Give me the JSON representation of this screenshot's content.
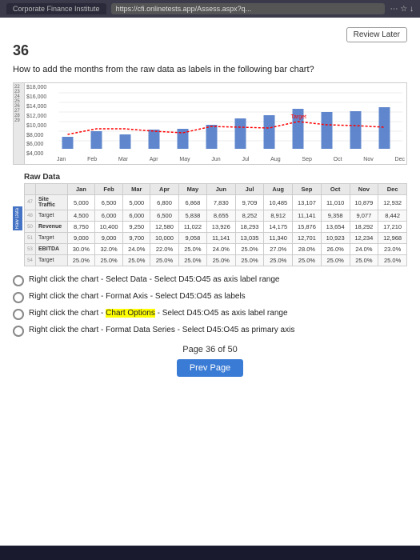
{
  "browser": {
    "tab_label": "Corporate Finance Institute",
    "url": "https://cfi.onlinetests.app/Assess.aspx?q...",
    "review_later": "Review Later"
  },
  "question": {
    "number": "36",
    "text": "How to add the months from the raw data as labels in the following bar chart?"
  },
  "chart": {
    "y_labels": [
      "$18,000",
      "$16,000",
      "$14,000",
      "$12,000",
      "$10,000",
      "$8,000",
      "$6,000",
      "$4,000"
    ],
    "x_labels": [
      "Jan",
      "Feb",
      "Mar",
      "Apr",
      "May",
      "Jun",
      "Jul",
      "Aug",
      "Sep",
      "Oct",
      "Nov",
      "Dec"
    ],
    "target_label": "Target"
  },
  "raw_data": {
    "title": "Raw Data",
    "columns": [
      "",
      "Jan",
      "Feb",
      "Mar",
      "Apr",
      "May",
      "Jun",
      "Jul",
      "Aug",
      "Sep",
      "Oct",
      "Nov",
      "Dec"
    ],
    "rows": [
      {
        "label": "Site Traffic",
        "row_num": "47",
        "values": [
          "5,000",
          "6,500",
          "5,000",
          "6,800",
          "6,868",
          "7,830",
          "9,709",
          "10,485",
          "13,107",
          "11,010",
          "10,879",
          "12,932"
        ]
      },
      {
        "label": "Target",
        "row_num": "48",
        "values": [
          "4,500",
          "6,000",
          "6,000",
          "6,500",
          "5,838",
          "8,655",
          "8,252",
          "8,912",
          "11,141",
          "9,358",
          "9,077",
          "8,442"
        ]
      },
      {
        "label": "Revenue",
        "row_num": "50",
        "values": [
          "8,750",
          "10,400",
          "9,250",
          "12,580",
          "11,022",
          "13,926",
          "18,293",
          "14,175",
          "15,876",
          "13,654",
          "18,292",
          "17,210"
        ]
      },
      {
        "label": "Target",
        "row_num": "51",
        "values": [
          "9,000",
          "9,000",
          "9,700",
          "10,000",
          "9,058",
          "11,141",
          "13,035",
          "11,340",
          "12,701",
          "10,923",
          "12,234",
          "12,968"
        ]
      },
      {
        "label": "EBITDA",
        "row_num": "53",
        "values": [
          "30.0%",
          "32.0%",
          "24.0%",
          "22.0%",
          "25.0%",
          "24.0%",
          "25.0%",
          "27.0%",
          "28.0%",
          "26.0%",
          "24.0%",
          "23.0%"
        ]
      },
      {
        "label": "Target",
        "row_num": "54",
        "values": [
          "25.0%",
          "25.0%",
          "25.0%",
          "25.0%",
          "25.0%",
          "25.0%",
          "25.0%",
          "25.0%",
          "25.0%",
          "25.0%",
          "25.0%",
          "25.0%"
        ]
      }
    ]
  },
  "options": [
    {
      "id": "opt1",
      "text": "Right click the chart - Select Data - Select D45:O45 as axis label range"
    },
    {
      "id": "opt2",
      "text": "Right click the chart - Format Axis - Select D45:O45 as labels"
    },
    {
      "id": "opt3",
      "text": "Right click the chart - Chart Options - Select D45:O45 as axis label range"
    },
    {
      "id": "opt4",
      "text": "Right click the chart - Format Data Series - Select D45:O45 as primary axis"
    }
  ],
  "pagination": {
    "current": "36",
    "total": "50",
    "page_label": "Page 36 of 50",
    "prev_label": "Prev Page"
  }
}
